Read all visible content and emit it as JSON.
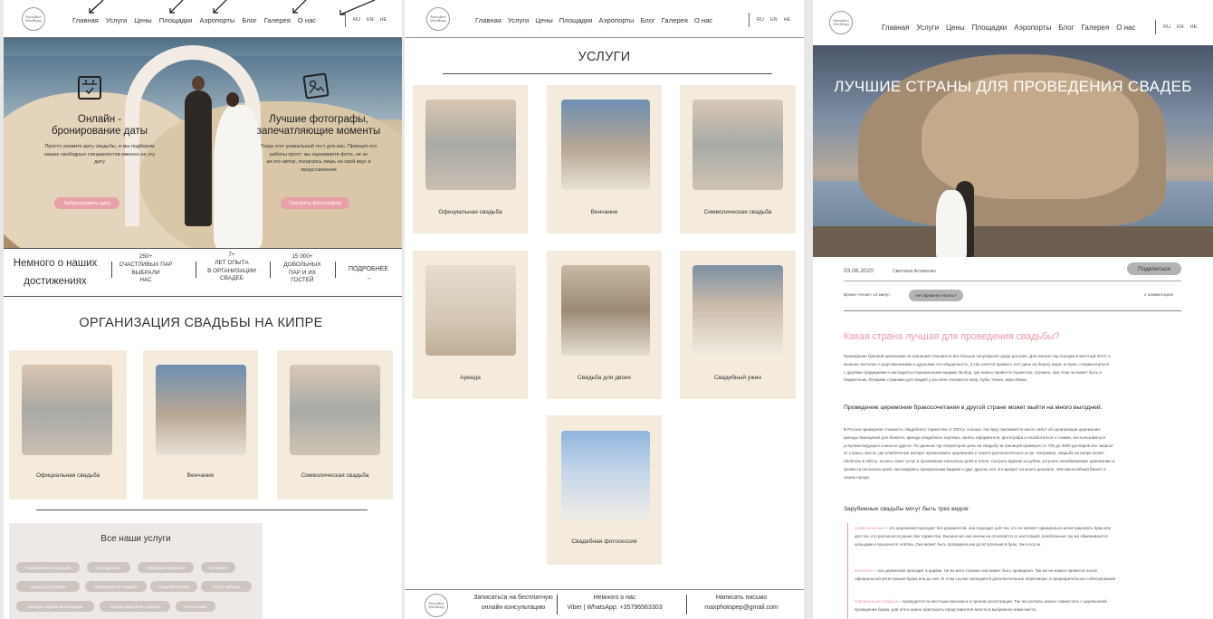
{
  "nav": {
    "logo_line1": "Paradise",
    "logo_line2": "Wedding",
    "items": [
      "Главная",
      "Услуги",
      "Цены",
      "Площадки",
      "Аэропорты",
      "Блог",
      "Галерея",
      "О нас"
    ],
    "langs": [
      "RU",
      "EN",
      "HE"
    ]
  },
  "home": {
    "feature1_title_l1": "Онлайн -",
    "feature1_title_l2": "бронирование даты",
    "feature1_text_l1": "Просто укажите дату свадьбы, и мы подберем",
    "feature1_text_l2": "наших свободных специалистов именно на эту",
    "feature1_text_l3": "дату",
    "feature1_btn": "Забронировать дату",
    "feature2_title_l1": "Лучшие фотографы,",
    "feature2_title_l2": "запечатляющие моменты",
    "feature2_text_l1": "Тогда этот уникальный тест для вас. Принцип его",
    "feature2_text_l2": "работы прост: вы оцениваете фото, не зн",
    "feature2_text_l3": "ая кто автор, полагаясь лишь на свой вкус и",
    "feature2_text_l4": "представления",
    "feature2_btn": "Смотреть фотографов",
    "stats_title_l1": "Немного о наших",
    "stats_title_l2": "достижениях",
    "stats": [
      {
        "l1": "250+",
        "l2": "счастливых пар",
        "l3": "выбрали",
        "l4": "нас"
      },
      {
        "l1": "7+",
        "l2": "лет опыта",
        "l3": "в организации",
        "l4": "свадеб"
      },
      {
        "l1": "15 000+",
        "l2": "довольных",
        "l3": "пар и их",
        "l4": "гостей"
      }
    ],
    "more_label": "Подробнее",
    "more_arrow": "→",
    "section_title": "ОРГАНИЗАЦИЯ СВАДЬБЫ НА КИПРЕ",
    "cards": [
      "Официальная свадьба",
      "Венчание",
      "Символическая свадьба"
    ],
    "all_services_title": "Все наши услуги",
    "tags": [
      "Символическая свадьба",
      "Аренда авто",
      "Свадебная прическа",
      "Венчание",
      "Свадьба для двоих",
      "Официальная свадьба",
      "Свадебный ужин",
      "Услуги аренды",
      "Аренда свадебной площадки",
      "Аренда свадебного декора",
      "Фотосъемка"
    ]
  },
  "services": {
    "title": "УСЛУГИ",
    "cards": [
      "Официальная свадьба",
      "Венчание",
      "Символическая свадьба",
      "Аренда",
      "Свадьба для двоих",
      "Свадебный ужин",
      "Свадебная фотосессия"
    ],
    "footer": {
      "col1_l1": "Записаться на бесплатную",
      "col1_l2": "онлайн консультацию",
      "col2_l1": "Немного о нас",
      "col2_l2": "Viber | WhatsApp: +35796563303",
      "col3_l1": "Написать письмо",
      "col3_l2": "maxphotopep@gmail.com"
    }
  },
  "blog": {
    "hero_title": "ЛУЧШИЕ СТРАНЫ ДЛЯ ПРОВЕДЕНИЯ СВАДЕБ",
    "date": "03.06.2020",
    "author": "Светлана Астапенко",
    "share_btn": "Поделиться",
    "read_time": "Время чтения: 13 минут",
    "no_time_btn": "Нет времени читать?",
    "comments": "2 комментария",
    "heading": "Какая страна лучшая для проведения свадьбы?",
    "para1_l1": "Проведение брачной церемонии за границей становится все больше популярной среди россиян. Для многих пар поездка в местный ЗАГС и",
    "para1_l2": "пышное застолье с родственниками и друзьями это обыденность, а так хочется прожить этот день на берегу моря, в горах, соприкоснуться",
    "para1_l3": "с другими традициями и насладиться прекрасными видами. Выбор, где можно провести торжество, огромен, при этом он может быть и",
    "para1_l4": "бюджетным. Лучшими странами для свадеб у россиян считаются Кипр, Куба, Чехия, Шри-Ланка.",
    "subheading": "Проведение церемонии бракосочетания в другой стране может выйти на много выгодней.",
    "para2_l1": "В России примерная стоимость свадебного торжества от 200т.р. и выше. На пару сваливается много забот об организации церемонии:",
    "para2_l2": "аренда помещения для банкета, аренда свадебного кортежа, нанять оформителя, фотографа и позаботиться о сэкаме, воспользоваться",
    "para2_l3": "услугами ведущего и многое другое. По данным тур операторов цены на свадьбу за границей примерно от 700 до 3500 долларов все зависит",
    "para2_l4": "от страны, места, где влюбленные желают организовать церемонию и пакета дополнительных услуг. Например, свадьба на Кипре может",
    "para2_l5": "обойтись в 150т.р. за весь пакет услуг и проживание несколько дней в отеле. Сыграть вдвоем за рубеж, устроить незабываемую церемонию и",
    "para2_l6": "провести несколько дней, наслаждаясь прекрасными видами и друг другом, все это выйдет на много дешевле, чем масштабный банкет в",
    "para2_l7": "своем городе.",
    "types_title": "Зарубежные свадьбы могут быть трех видов:",
    "t1_key": "Символическая",
    "t1_l1": " – это церемония проходит без документов, она подходит для тех, кто не желает официально регистрировать брак или",
    "t1_l2": "для тех, кто расписался ранее без торжества. Внешне же она ничем не отличается от настоящей, влюбленные так же обмениваются",
    "t1_l3": "кольцами и произносят клятвы. Она может быть проведена как до вступления в брак, так и после.",
    "t2_key": "Венчание",
    "t2_l1": " – эта церемония проходит в церкви. Не во всех странах она может быть проведена. Так же ее можно провести после",
    "t2_l2": "официальной регистрации брака или до нее. В этом случае проводятся дополнительные переговоры и предварительное собеседование.",
    "t3_key": "Официальная свадьба",
    "t3_l1": " – проводится по местным законам и в органах регистрации. Так же роспись можно совместить с церемонией",
    "t3_l2": "проведения брака, для этого нужно пригласить представителя власти в выбранное вами место."
  }
}
